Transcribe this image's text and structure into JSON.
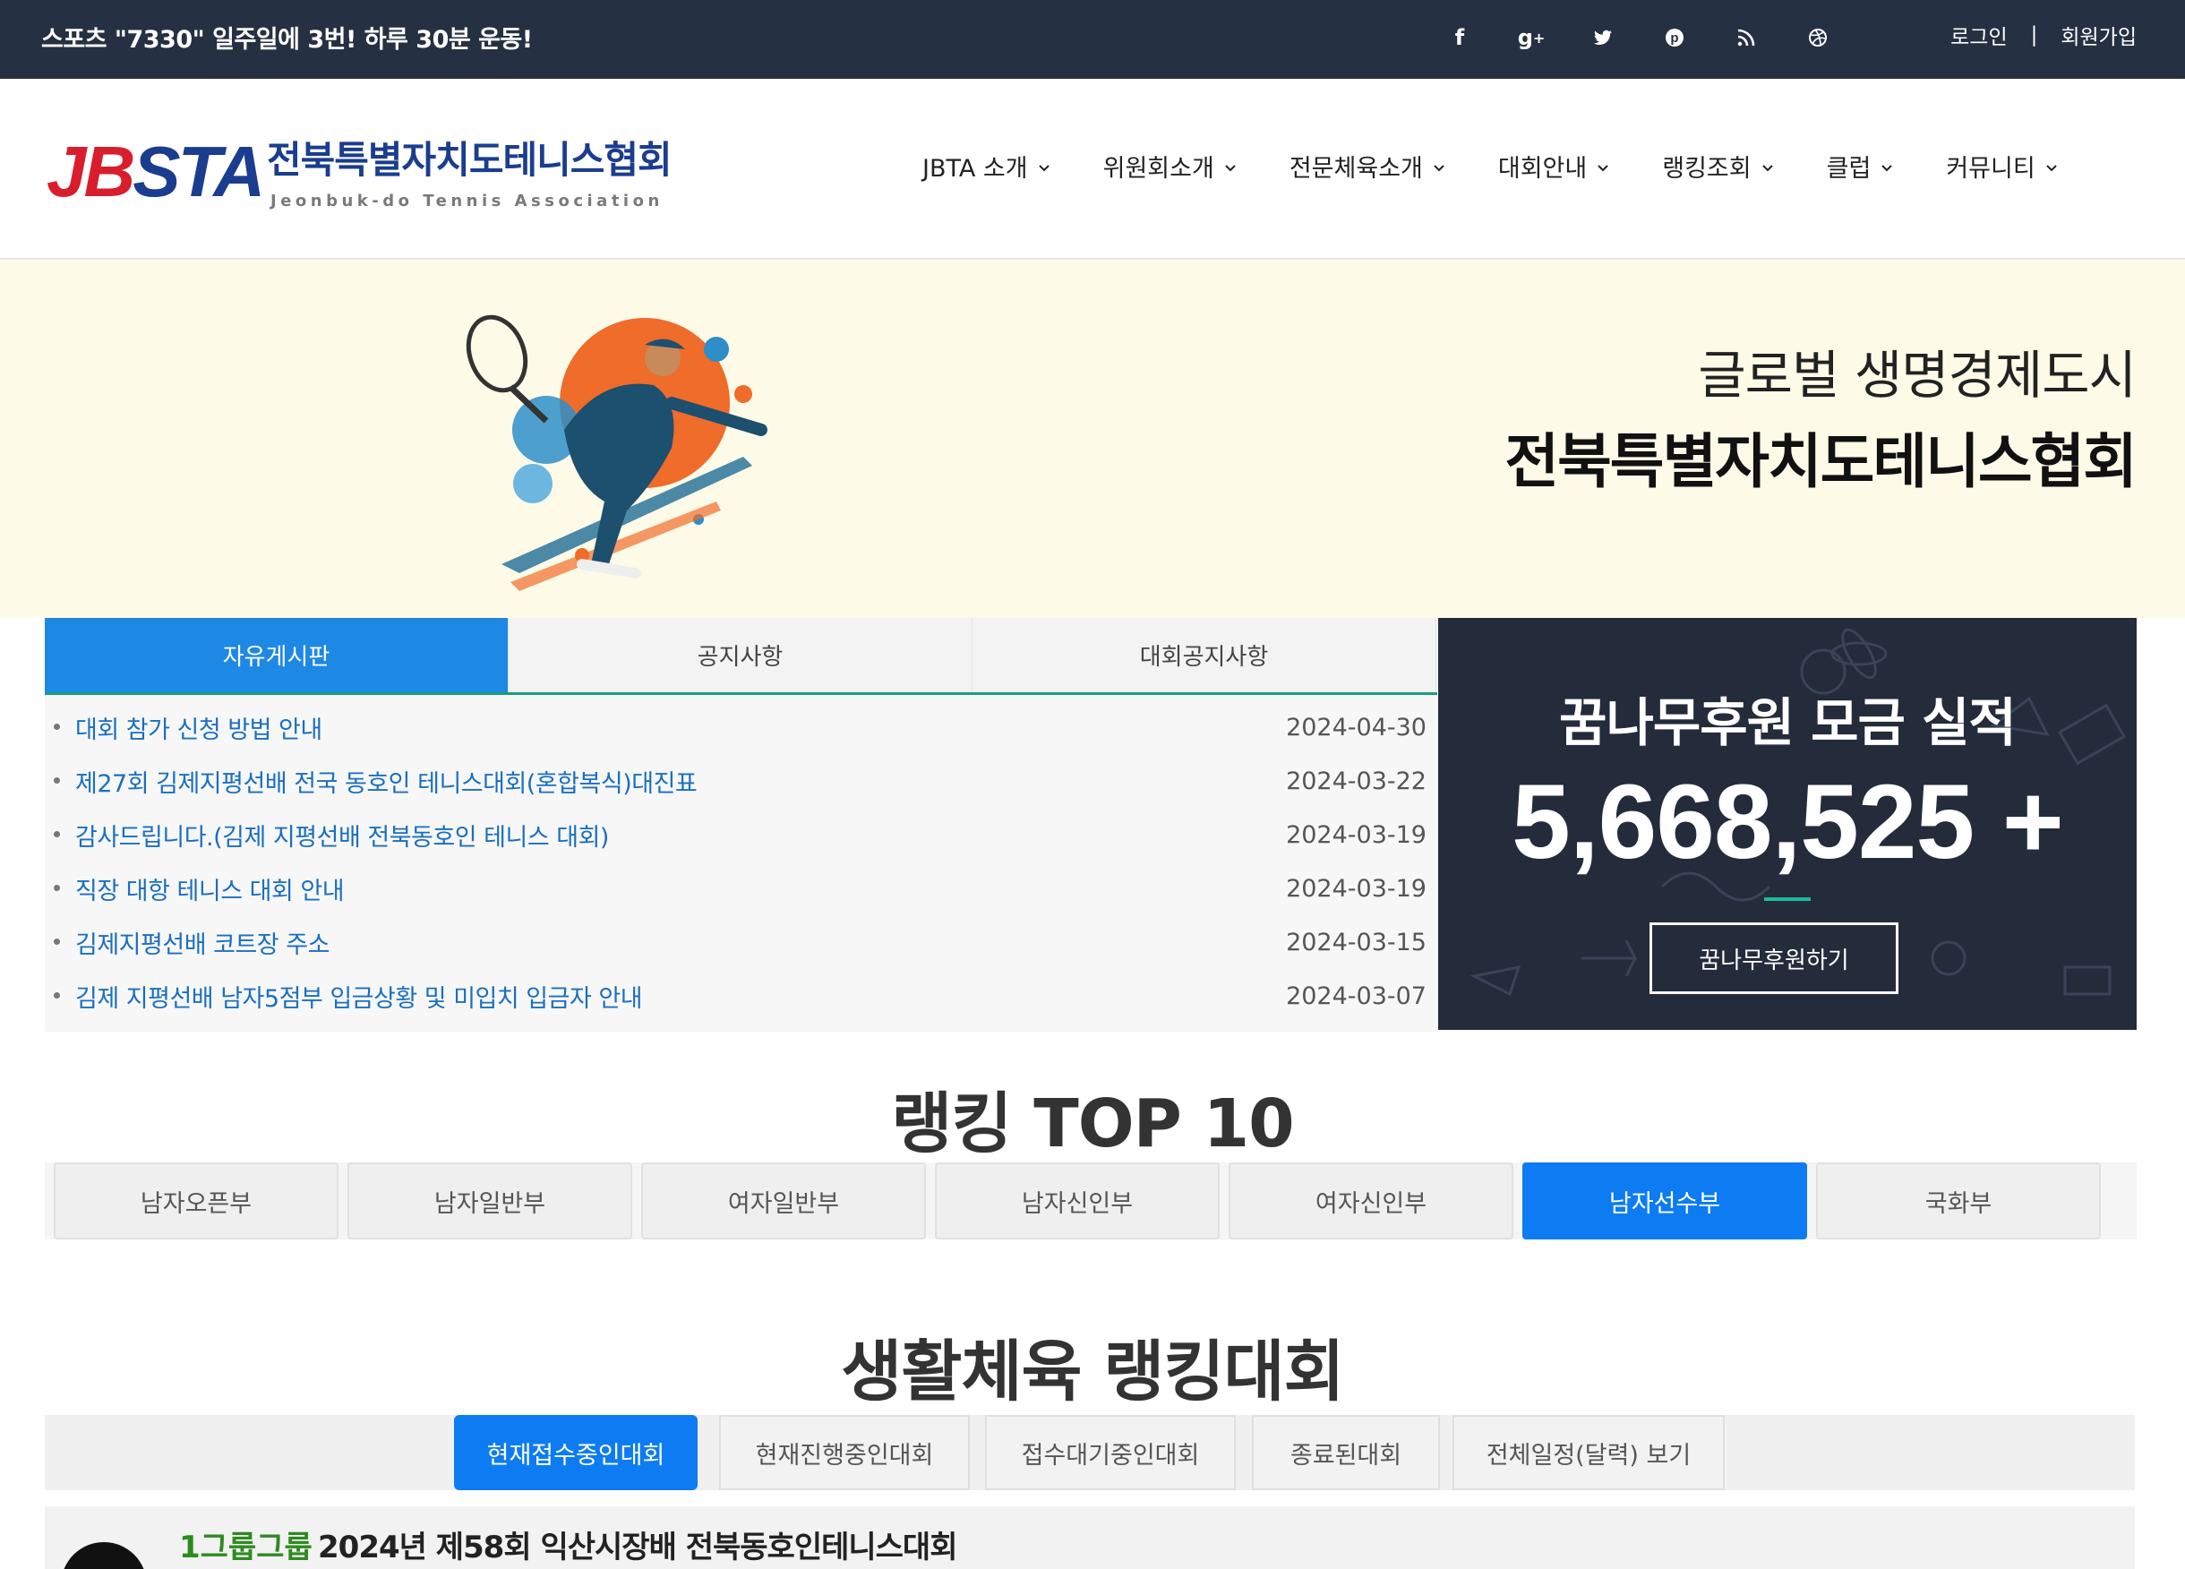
{
  "topbar": {
    "slogan": "스포츠 \"7330\" 일주일에 3번! 하루 30분 운동!",
    "socials": [
      "facebook-icon",
      "google-plus-icon",
      "twitter-icon",
      "pinterest-icon",
      "rss-icon",
      "dribbble-icon"
    ],
    "login": "로그인",
    "separator": "|",
    "signup": "회원가입"
  },
  "header": {
    "logo_mark_red": "JB",
    "logo_mark_blue": "STA",
    "logo_kname": "전북특별자치도테니스협회",
    "logo_ename": "Jeonbuk-do Tennis Association",
    "nav": [
      "JBTA 소개",
      "위원회소개",
      "전문체육소개",
      "대회안내",
      "랭킹조회",
      "클럽",
      "커뮤니티"
    ]
  },
  "hero": {
    "line1": "글로벌 생명경제도시",
    "line2": "전북특별자치도테니스협회"
  },
  "board": {
    "tabs": [
      "자유게시판",
      "공지사항",
      "대회공지사항"
    ],
    "active_tab": "자유게시판",
    "posts": [
      {
        "title": "대회 참가 신청 방법 안내",
        "date": "2024-04-30"
      },
      {
        "title": "제27회 김제지평선배 전국 동호인 테니스대회(혼합복식)대진표",
        "date": "2024-03-22"
      },
      {
        "title": "감사드립니다.(김제 지평선배 전북동호인 테니스 대회)",
        "date": "2024-03-19"
      },
      {
        "title": "직장 대항 테니스 대회 안내",
        "date": "2024-03-19"
      },
      {
        "title": "김제지평선배 코트장 주소",
        "date": "2024-03-15"
      },
      {
        "title": "김제 지평선배 남자5점부 입금상황 및 미입치 입금자 안내",
        "date": "2024-03-07"
      }
    ]
  },
  "donation": {
    "title": "꿈나무후원 모금 실적",
    "amount": "5,668,525 +",
    "button": "꿈나무후원하기"
  },
  "ranking": {
    "title": "랭킹 TOP 10",
    "tabs": [
      "남자오픈부",
      "남자일반부",
      "여자일반부",
      "남자신인부",
      "여자신인부",
      "남자선수부",
      "국화부"
    ],
    "active": "남자선수부"
  },
  "life": {
    "title": "생활체육 랭킹대회",
    "tabs": [
      "현재접수중인대회",
      "현재진행중인대회",
      "접수대기중인대회",
      "종료된대회",
      "전체일정(달력) 보기"
    ],
    "active": "현재접수중인대회",
    "featured_group": "1그룹그룹",
    "featured_title": "2024년 제58회 익산시장배 전북동호인테니스대회"
  },
  "colors": {
    "topbar": "#263043",
    "accent_blue": "#0d7cf2",
    "tab_blue": "#1e88e5",
    "teal": "#1a9c7f",
    "hero_bg": "#fdfbe8",
    "donation_bg": "#242b3b",
    "logo_red": "#d81e2c",
    "logo_blue": "#1b3d8f"
  }
}
